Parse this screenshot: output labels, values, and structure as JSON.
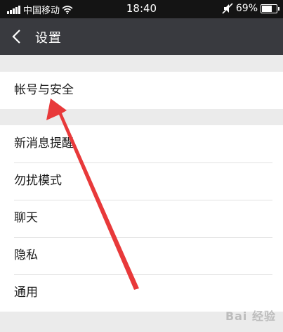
{
  "status_bar": {
    "carrier": "中国移动",
    "time": "18:40",
    "battery_percent": "69%",
    "battery_level": 0.69,
    "icons": [
      "signal-icon",
      "wifi-icon",
      "mute-icon",
      "battery-icon"
    ]
  },
  "nav": {
    "back_icon": "chevron-left-icon",
    "title": "设置"
  },
  "groups": [
    {
      "items": [
        {
          "label": "帐号与安全"
        }
      ]
    },
    {
      "items": [
        {
          "label": "新消息提醒"
        },
        {
          "label": "勿扰模式"
        },
        {
          "label": "聊天"
        },
        {
          "label": "隐私"
        },
        {
          "label": "通用"
        }
      ]
    }
  ],
  "annotation": {
    "color": "#e8393a"
  },
  "watermark": {
    "text": "Bai 经验"
  },
  "colors": {
    "status_bar_bg": "#141414",
    "nav_bg": "#393a3f",
    "page_bg": "#ebebeb",
    "row_bg": "#ffffff"
  }
}
